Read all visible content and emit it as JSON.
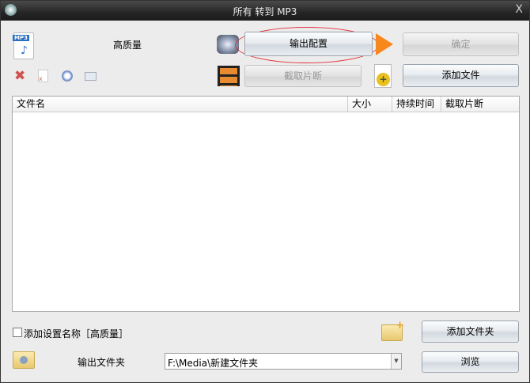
{
  "window": {
    "title": "所有 转到 MP3",
    "close": "X"
  },
  "profile": {
    "quality": "高质量",
    "output_config": "输出配置",
    "confirm": "确定",
    "clip": "截取片断",
    "add_file": "添加文件",
    "mp3_icon_text": "MP3"
  },
  "table": {
    "columns": [
      "文件名",
      "大小",
      "持续时间",
      "截取片断"
    ],
    "rows": []
  },
  "bottom": {
    "add_name_label": "添加设置名称［高质量］",
    "add_name_checked": false,
    "add_folder": "添加文件夹",
    "output_folder_label": "输出文件夹",
    "output_path": "F:\\Media\\新建文件夹",
    "browse": "浏览"
  }
}
